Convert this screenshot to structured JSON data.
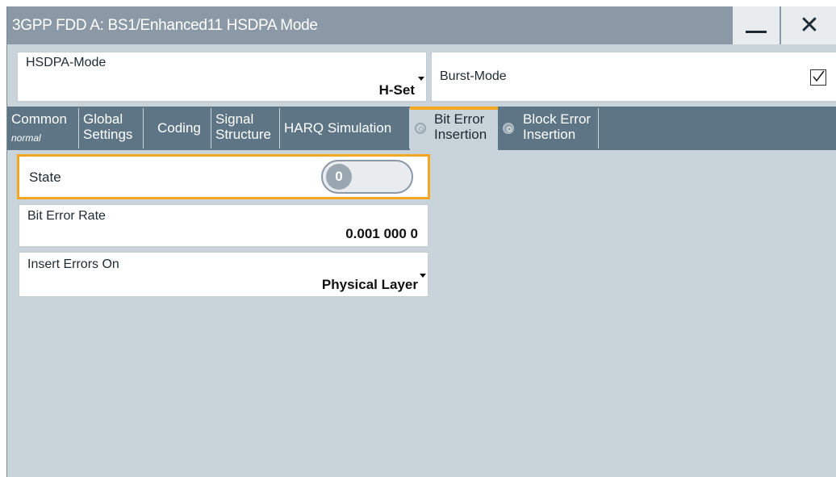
{
  "window": {
    "title": "3GPP FDD A: BS1/Enhanced11 HSDPA Mode",
    "minimize_icon": "minimize-icon",
    "close_label": "✕"
  },
  "hsdpa_mode": {
    "label": "HSDPA-Mode",
    "value": "H-Set"
  },
  "burst_mode": {
    "label": "Burst-Mode",
    "checked": true
  },
  "tabs": [
    {
      "line1": "Common",
      "line2": "normal"
    },
    {
      "line1": "Global",
      "line2": "Settings"
    },
    {
      "line1": "Coding"
    },
    {
      "line1": "Signal",
      "line2": "Structure"
    },
    {
      "line1": "HARQ Simulation"
    },
    {
      "line1": "Bit Error",
      "line2": "Insertion",
      "active": true,
      "icon": "radio-off-icon"
    },
    {
      "line1": "Block Error",
      "line2": "Insertion",
      "icon": "radio-off-icon"
    }
  ],
  "state": {
    "label": "State",
    "value": "0"
  },
  "bit_error_rate": {
    "label": "Bit Error Rate",
    "value": "0.001 000 0"
  },
  "insert_errors_on": {
    "label": "Insert Errors On",
    "value": "Physical Layer"
  },
  "colors": {
    "accent": "#f5a623",
    "title_bar": "#8b99a6",
    "tab_bar": "#5d7585",
    "panel": "#c9d3da"
  }
}
